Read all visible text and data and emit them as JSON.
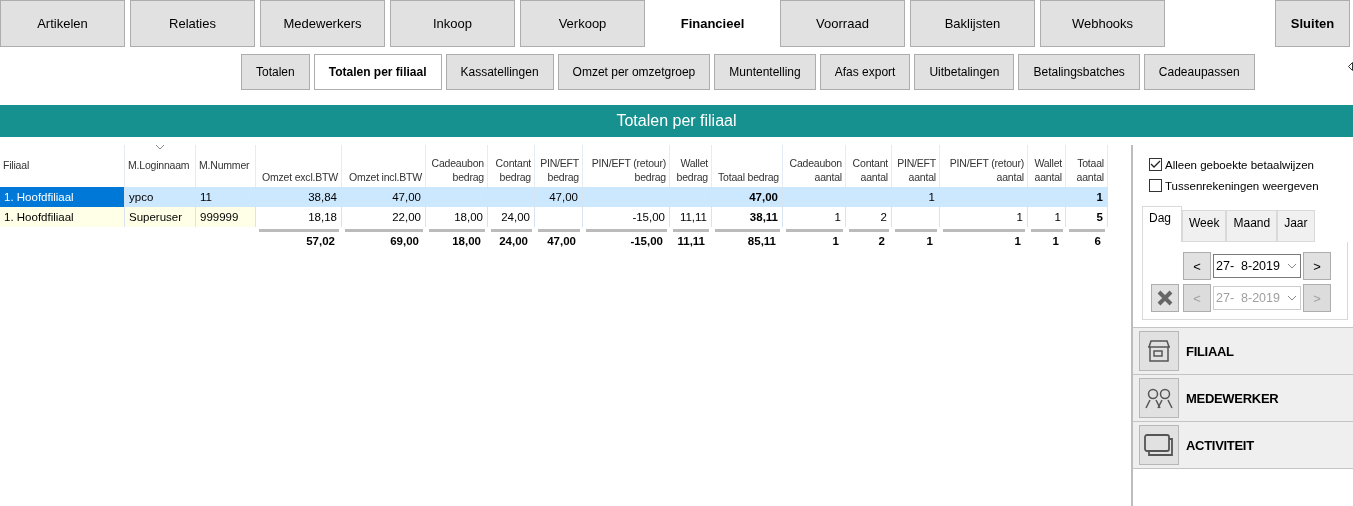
{
  "main_tabs": [
    {
      "label": "Artikelen",
      "selected": false
    },
    {
      "label": "Relaties",
      "selected": false
    },
    {
      "label": "Medewerkers",
      "selected": false
    },
    {
      "label": "Inkoop",
      "selected": false
    },
    {
      "label": "Verkoop",
      "selected": false
    },
    {
      "label": "Financieel",
      "selected": true
    },
    {
      "label": "Voorraad",
      "selected": false
    },
    {
      "label": "Baklijsten",
      "selected": false
    },
    {
      "label": "Webhooks",
      "selected": false
    }
  ],
  "close_button": "Sluiten",
  "sub_tabs": [
    {
      "label": "Totalen",
      "selected": false
    },
    {
      "label": "Totalen per filiaal",
      "selected": true
    },
    {
      "label": "Kassatellingen",
      "selected": false
    },
    {
      "label": "Omzet per omzetgroep",
      "selected": false
    },
    {
      "label": "Muntentelling",
      "selected": false
    },
    {
      "label": "Afas export",
      "selected": false
    },
    {
      "label": "Uitbetalingen",
      "selected": false
    },
    {
      "label": "Betalingsbatches",
      "selected": false
    },
    {
      "label": "Cadeaupassen",
      "selected": false
    }
  ],
  "title": "Totalen per filiaal",
  "table": {
    "columns": [
      {
        "label": "Filiaal",
        "sorted": false
      },
      {
        "label": "M.Loginnaam",
        "sorted": true
      },
      {
        "label": "M.Nummer",
        "sorted": false
      },
      {
        "label": "Omzet excl.BTW",
        "sorted": false
      },
      {
        "label": "Omzet incl.BTW",
        "sorted": false
      },
      {
        "label": "Cadeaubon bedrag",
        "sorted": false
      },
      {
        "label": "Contant bedrag",
        "sorted": false
      },
      {
        "label": "PIN/EFT bedrag",
        "sorted": false
      },
      {
        "label": "PIN/EFT (retour) bedrag",
        "sorted": false
      },
      {
        "label": "Wallet bedrag",
        "sorted": false
      },
      {
        "label": "Totaal bedrag",
        "sorted": false
      },
      {
        "label": "Cadeaubon aantal",
        "sorted": false
      },
      {
        "label": "Contant aantal",
        "sorted": false
      },
      {
        "label": "PIN/EFT aantal",
        "sorted": false
      },
      {
        "label": "PIN/EFT (retour) aantal",
        "sorted": false
      },
      {
        "label": "Wallet aantal",
        "sorted": false
      },
      {
        "label": "Totaal aantal",
        "sorted": false
      }
    ],
    "rows": [
      {
        "selected": true,
        "cells": [
          "1. Hoofdfiliaal",
          "ypco",
          "11",
          "38,84",
          "47,00",
          "",
          "",
          "47,00",
          "",
          "",
          "47,00",
          "",
          "",
          "1",
          "",
          "",
          "1"
        ]
      },
      {
        "selected": false,
        "cells": [
          "1. Hoofdfiliaal",
          "Superuser",
          "999999",
          "18,18",
          "22,00",
          "18,00",
          "24,00",
          "",
          "-15,00",
          "11,11",
          "38,11",
          "1",
          "2",
          "",
          "1",
          "1",
          "5"
        ]
      }
    ],
    "totals": [
      "57,02",
      "69,00",
      "18,00",
      "24,00",
      "47,00",
      "-15,00",
      "11,11",
      "85,11",
      "1",
      "2",
      "1",
      "1",
      "1",
      "6"
    ]
  },
  "options": [
    {
      "label": "Alleen geboekte betaalwijzen",
      "checked": true
    },
    {
      "label": "Tussenrekeningen weergeven",
      "checked": false
    }
  ],
  "period_tabs": [
    {
      "label": "Dag",
      "selected": true
    },
    {
      "label": "Week",
      "selected": false
    },
    {
      "label": "Maand",
      "selected": false
    },
    {
      "label": "Jaar",
      "selected": false
    }
  ],
  "date_from": {
    "prev": "<",
    "value": "27-  8-2019",
    "next": ">",
    "disabled": false
  },
  "date_to": {
    "prev": "<",
    "value": "27-  8-2019",
    "next": ">",
    "disabled": true
  },
  "sections": [
    {
      "label": "FILIAAL",
      "kind": "store"
    },
    {
      "label": "MEDEWERKER",
      "kind": "people"
    },
    {
      "label": "ACTIVITEIT",
      "kind": "windows"
    }
  ]
}
